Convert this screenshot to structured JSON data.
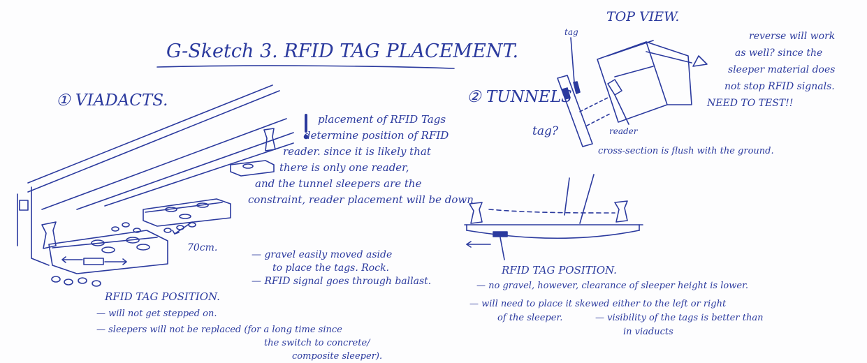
{
  "title": "G-Sketch 3. RFID TAG PLACEMENT.",
  "viaducts": {
    "heading": "① VIADACTS.",
    "dimension": "70cm.",
    "placement_note": [
      "placement of RFID Tags",
      "determine position of RFID",
      "reader. since it is likely that",
      "there is only one reader,",
      "and the tunnel sleepers are the",
      "constraint, reader placement will be down"
    ],
    "pros": [
      "— gravel easily moved aside",
      "to place the tags. Rock.",
      "— RFID signal goes through ballast."
    ],
    "position_heading": "RFID TAG POSITION.",
    "position_notes": [
      "— will not get stepped on.",
      "— sleepers will not be replaced (for a long time since",
      "the switch to concrete/",
      "composite sleeper)."
    ]
  },
  "tunnels": {
    "heading": "② TUNNELS",
    "top_view": "TOP VIEW.",
    "tag_label": "tag",
    "tag_question": "tag?",
    "reader_label": "reader",
    "reverse_note": [
      "reverse will work",
      "as well? since the",
      "sleeper material does",
      "not stop RFID signals.",
      "NEED TO TEST!!"
    ],
    "cross_section_note": "cross-section is flush with the ground.",
    "position_heading": "RFID TAG POSITION.",
    "position_notes": [
      "— no gravel, however, clearance of sleeper height is lower.",
      "— will need to place it skewed either to the left or right",
      "of the sleeper.",
      "— visibility of the tags is better than",
      "in viaducts"
    ]
  },
  "colors": {
    "ink": "#2b3a9e",
    "paper": "#fdfdfe"
  }
}
